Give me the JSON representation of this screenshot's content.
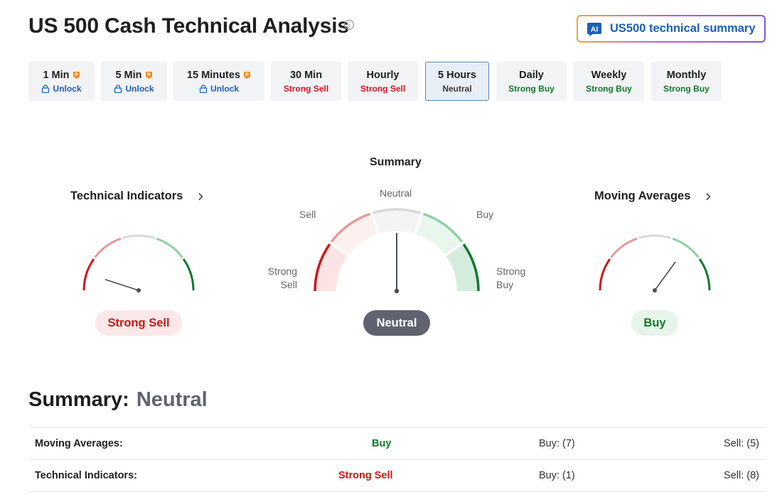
{
  "page": {
    "title": "US 500 Cash Technical Analysis",
    "ai_button_label": "US500 technical summary"
  },
  "tabs": [
    {
      "label": "1 Min",
      "status": "Unlock",
      "locked": true
    },
    {
      "label": "5 Min",
      "status": "Unlock",
      "locked": true
    },
    {
      "label": "15 Minutes",
      "status": "Unlock",
      "locked": true
    },
    {
      "label": "30 Min",
      "status": "Strong Sell",
      "locked": false
    },
    {
      "label": "Hourly",
      "status": "Strong Sell",
      "locked": false
    },
    {
      "label": "5 Hours",
      "status": "Neutral",
      "locked": false,
      "active": true
    },
    {
      "label": "Daily",
      "status": "Strong Buy",
      "locked": false
    },
    {
      "label": "Weekly",
      "status": "Strong Buy",
      "locked": false
    },
    {
      "label": "Monthly",
      "status": "Strong Buy",
      "locked": false
    }
  ],
  "gauges": {
    "summary_heading": "Summary",
    "technical_indicators": {
      "title": "Technical Indicators",
      "signal": "Strong Sell"
    },
    "summary": {
      "signal": "Neutral"
    },
    "moving_averages": {
      "title": "Moving Averages",
      "signal": "Buy"
    },
    "zone_labels": {
      "strong_sell": "Strong\nSell",
      "sell": "Sell",
      "neutral": "Neutral",
      "buy": "Buy",
      "strong_buy": "Strong\nBuy"
    }
  },
  "summary_line": {
    "label": "Summary:",
    "value": "Neutral"
  },
  "table": [
    {
      "name": "Moving Averages:",
      "signal": "Buy",
      "buy": "Buy: (7)",
      "sell": "Sell: (5)"
    },
    {
      "name": "Technical Indicators:",
      "signal": "Strong Sell",
      "buy": "Buy: (1)",
      "sell": "Sell: (8)"
    }
  ],
  "colors": {
    "strong_sell": "#d0161b",
    "sell": "#e59a98",
    "neutral": "#d9d9d9",
    "buy": "#8fd0a5",
    "strong_buy": "#107a2c",
    "accent": "#1a5fb4"
  }
}
